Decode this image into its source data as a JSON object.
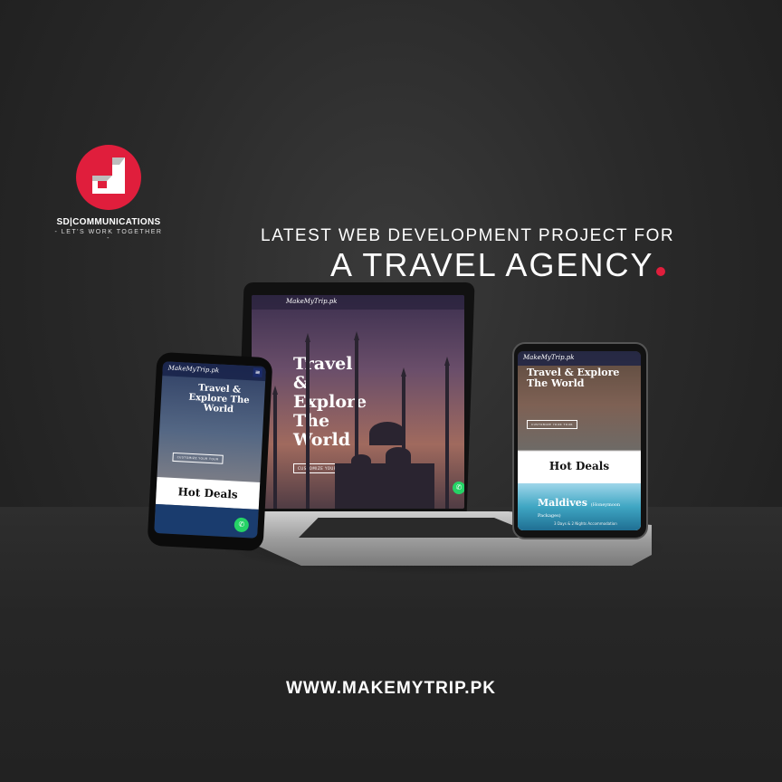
{
  "brand": {
    "name": "SD|COMMUNICATIONS",
    "tagline": "- LET'S WORK TOGETHER -",
    "accent_color": "#e01e3c"
  },
  "headline": {
    "line1": "LATEST WEB DEVELOPMENT PROJECT FOR",
    "line2": "A TRAVEL AGENCY"
  },
  "website": {
    "logo": "MakeMyTrip.pk",
    "hero_title_laptop": "Travel & Explore The World",
    "hero_title_mobile": "Travel & Explore The World",
    "cta": "CUSTOMIZE YOUR TOUR",
    "hot_deals": "Hot Deals",
    "deal_title": "Maldives",
    "deal_sub": "(Honeymoon Packages)",
    "deal_meta": "3 Days & 2 Nights Accommodation"
  },
  "footer": {
    "url": "WWW.MAKEMYTRIP.PK"
  }
}
